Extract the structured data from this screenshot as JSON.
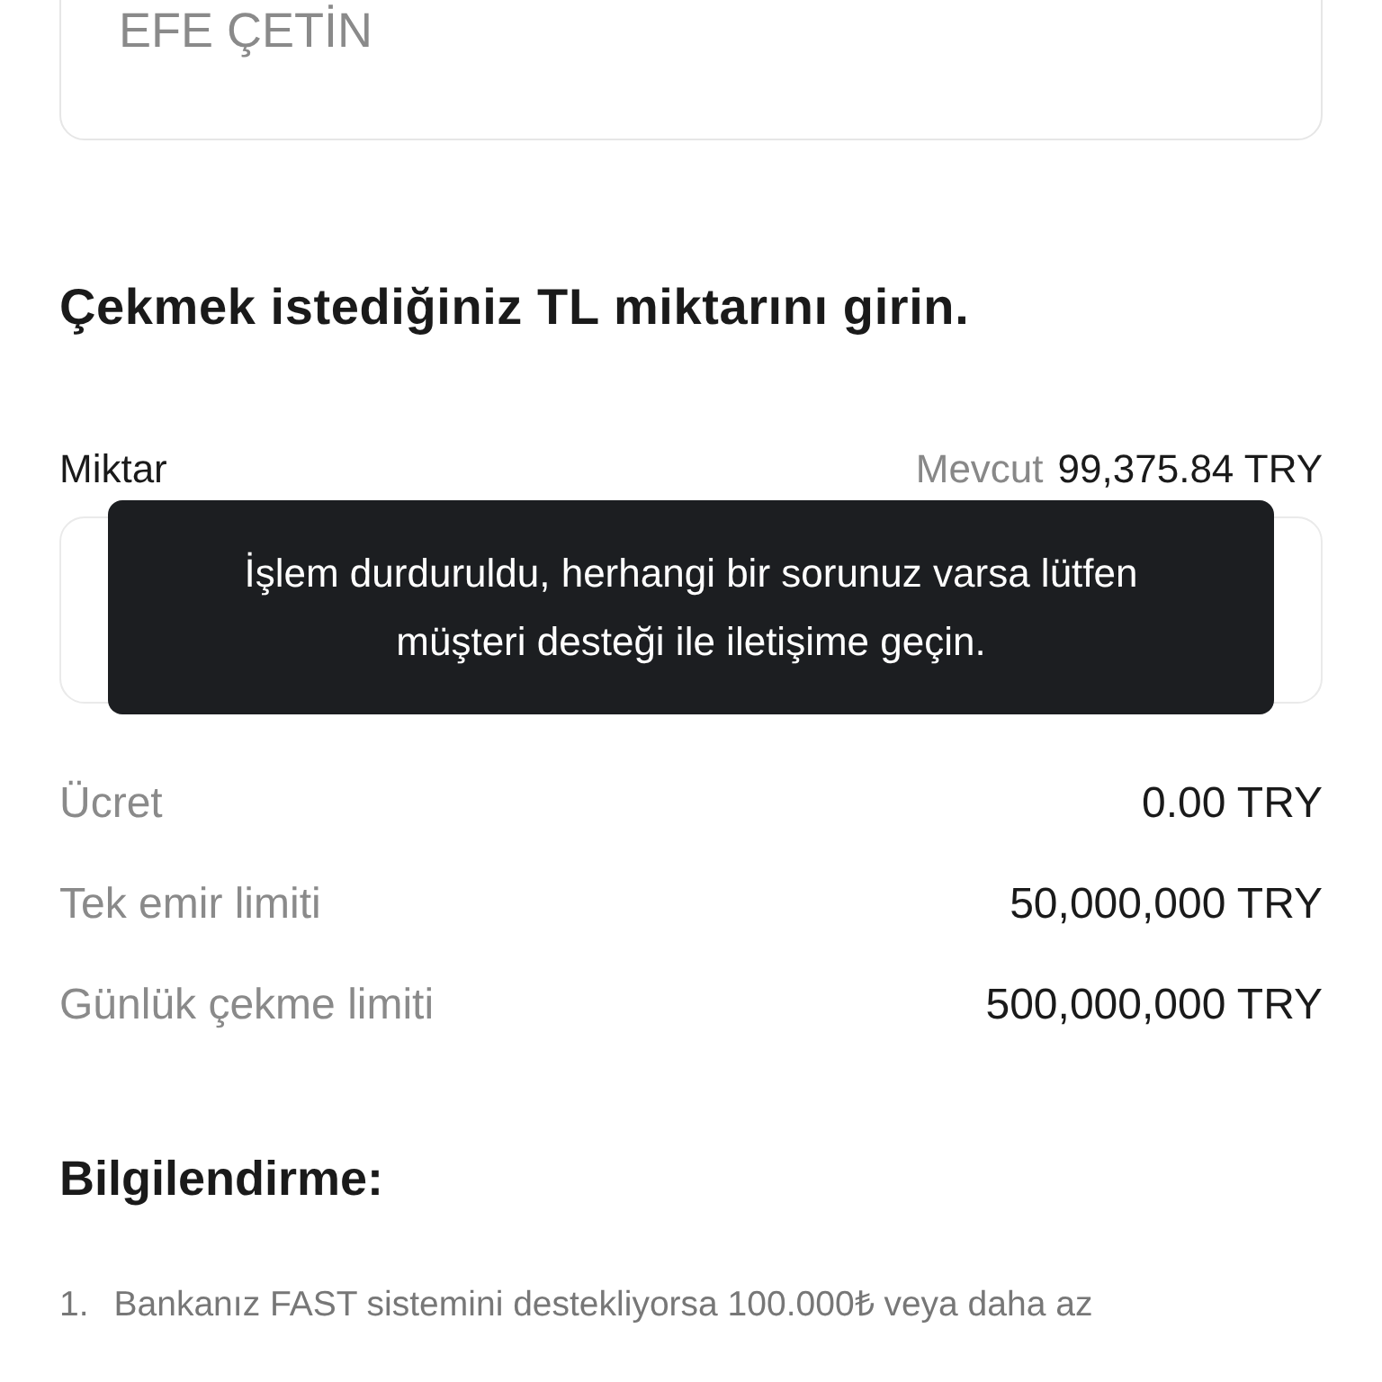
{
  "name_field": {
    "value": "EFE ÇETİN"
  },
  "heading": "Çekmek istediğiniz TL miktarını girin.",
  "amount": {
    "label": "Miktar",
    "available_label": "Mevcut",
    "available_value": "99,375.84 TRY"
  },
  "toast": {
    "message": "İşlem durduruldu, herhangi bir sorunuz varsa lütfen müşteri desteği ile iletişime geçin."
  },
  "details": [
    {
      "label": "Ücret",
      "value": "0.00 TRY"
    },
    {
      "label": "Tek emir limiti",
      "value": "50,000,000 TRY"
    },
    {
      "label": "Günlük çekme limiti",
      "value": "500,000,000 TRY"
    }
  ],
  "info": {
    "title": "Bilgilendirme:",
    "items": [
      {
        "number": "1.",
        "text": "Bankanız FAST sistemini destekliyorsa 100.000₺ veya daha az"
      }
    ]
  }
}
